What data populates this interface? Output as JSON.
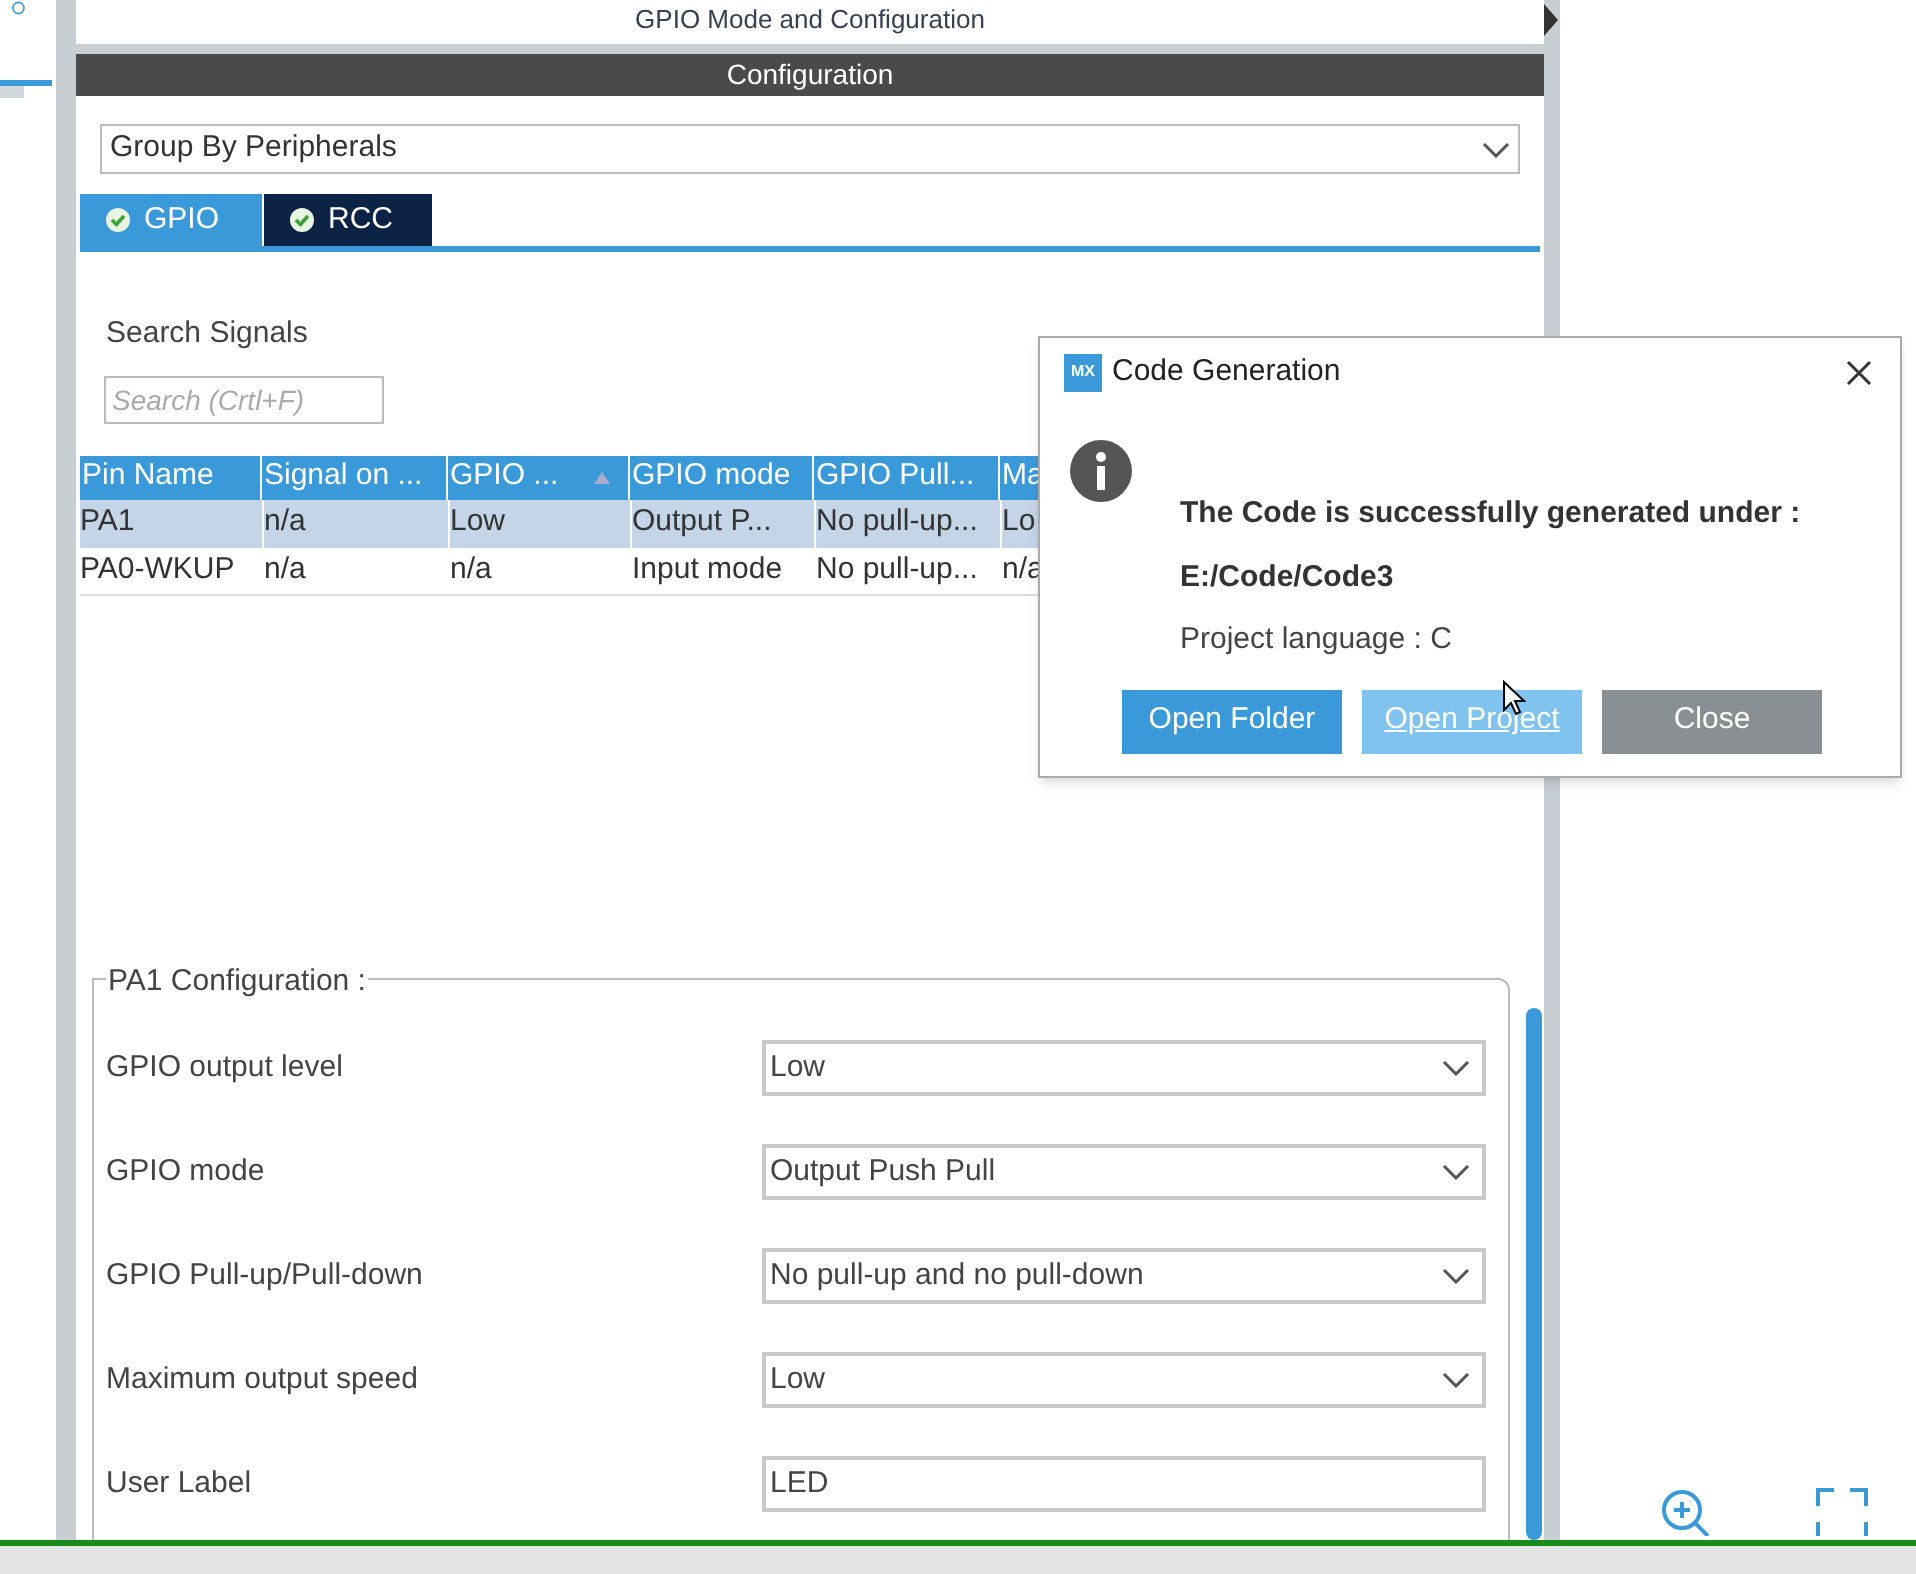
{
  "panel": {
    "title": "GPIO Mode and Configuration"
  },
  "configuration": {
    "title": "Configuration",
    "group_select": {
      "value": "Group By Peripherals"
    },
    "tabs": [
      {
        "label": "GPIO",
        "selected": true
      },
      {
        "label": "RCC",
        "selected": false
      }
    ],
    "search": {
      "label": "Search Signals",
      "placeholder": "Search (Crtl+F)"
    },
    "table": {
      "columns": [
        {
          "label": "Pin Name"
        },
        {
          "label": "Signal on ..."
        },
        {
          "label": "GPIO ...",
          "sorted": true
        },
        {
          "label": "GPIO mode"
        },
        {
          "label": "GPIO Pull..."
        },
        {
          "label": "Ma"
        }
      ],
      "rows": [
        {
          "selected": true,
          "cells": [
            "PA1",
            "n/a",
            "Low",
            "Output P...",
            "No pull-up...",
            "Lo"
          ]
        },
        {
          "selected": false,
          "cells": [
            "PA0-WKUP",
            "n/a",
            "n/a",
            "Input mode",
            "No pull-up...",
            "n/a"
          ]
        }
      ]
    },
    "pin_config": {
      "title": "PA1 Configuration :",
      "fields": [
        {
          "label": "GPIO output level",
          "value": "Low",
          "kind": "select"
        },
        {
          "label": "GPIO mode",
          "value": "Output Push Pull",
          "kind": "select"
        },
        {
          "label": "GPIO Pull-up/Pull-down",
          "value": "No pull-up and no pull-down",
          "kind": "select"
        },
        {
          "label": "Maximum output speed",
          "value": "Low",
          "kind": "select"
        },
        {
          "label": "User Label",
          "value": "LED",
          "kind": "text"
        }
      ]
    }
  },
  "dialog": {
    "badge": "MX",
    "title": "Code Generation",
    "message": "The Code is successfully generated under :",
    "path": "E:/Code/Code3",
    "language": "Project language : C",
    "buttons": [
      {
        "label": "Open Folder",
        "kind": "primary"
      },
      {
        "label": "Open Project",
        "kind": "hover"
      },
      {
        "label": "Close",
        "kind": "secondary"
      }
    ]
  }
}
